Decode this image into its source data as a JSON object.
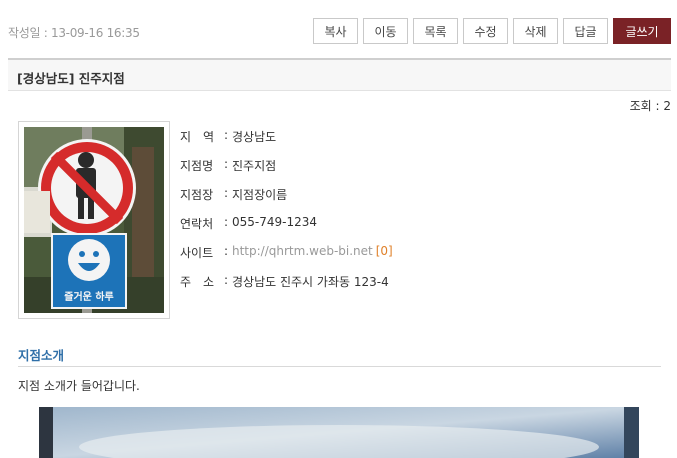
{
  "header": {
    "date_label": "작성일 : 13-09-16 16:35",
    "buttons": [
      "복사",
      "이동",
      "목록",
      "수정",
      "삭제",
      "답글",
      "글쓰기"
    ]
  },
  "post": {
    "title": "[경상남도] 진주지점",
    "views": "조회 : 2"
  },
  "photo": {
    "sign_text": "즐거운 하루"
  },
  "info": {
    "region_label": "지　역",
    "region_value": "경상남도",
    "branch_label": "지점명",
    "branch_value": "진주지점",
    "manager_label": "지점장",
    "manager_value": "지점장이름",
    "phone_label": "연락처",
    "phone_value": "055-749-1234",
    "site_label": "사이트",
    "site_value": "http://qhrtm.web-bi.net",
    "site_count": "[0]",
    "address_label": "주　소",
    "address_value": "경상남도 진주시 가좌동 123-4",
    "separator": ":"
  },
  "section": {
    "heading": "지점소개",
    "intro": "지점 소개가 들어갑니다."
  },
  "colors": {
    "primary_button": "#7a2226",
    "section_heading": "#2f6fa8",
    "link_count": "#e0812a"
  }
}
